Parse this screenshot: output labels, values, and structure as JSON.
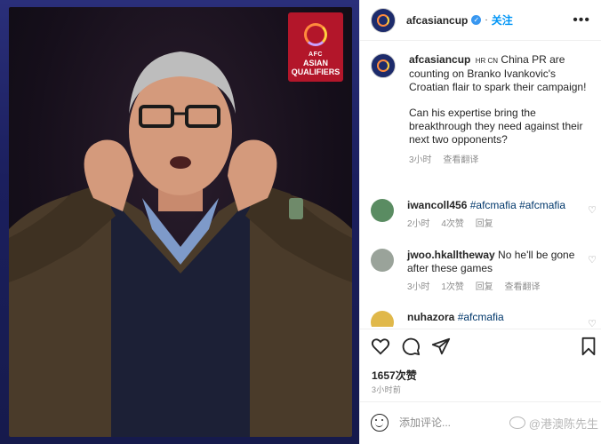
{
  "image": {
    "badge_line1": "AFC",
    "badge_line2": "ASIAN",
    "badge_line3": "QUALIFIERS"
  },
  "header": {
    "username": "afcasiancup",
    "follow_label": "关注",
    "more_icon": "more-horizontal-icon"
  },
  "caption": {
    "username": "afcasiancup",
    "flags": "HR CN",
    "text1": "China PR are counting on Branko Ivankovic's Croatian flair to spark their campaign!",
    "text2": "Can his expertise bring the breakthrough they need against their next two opponents?",
    "time": "3小时",
    "translate": "查看翻译"
  },
  "comments": [
    {
      "username": "iwancoll456",
      "text": "#afcmafia #afcmafia",
      "time": "2小时",
      "likes": "4次赞",
      "reply": "回复",
      "translate": ""
    },
    {
      "username": "jwoo.hkalltheway",
      "text": "No he'll be gone after these games",
      "time": "3小时",
      "likes": "1次赞",
      "reply": "回复",
      "translate": "查看翻译"
    },
    {
      "username": "nuhazora",
      "text": "#afcmafia",
      "time": "",
      "likes": "",
      "reply": "",
      "translate": ""
    }
  ],
  "actions": {
    "like_icon": "heart-icon",
    "comment_icon": "comment-icon",
    "share_icon": "send-icon",
    "save_icon": "bookmark-icon"
  },
  "likes_text": "1657次赞",
  "posted_time": "3小时前",
  "add_comment": {
    "placeholder": "添加评论...",
    "watermark": "@港澳陈先生"
  },
  "colors": {
    "accent_blue": "#0095f6",
    "badge_red": "#b3162a",
    "text_primary": "#262626",
    "text_secondary": "#8e8e8e"
  }
}
